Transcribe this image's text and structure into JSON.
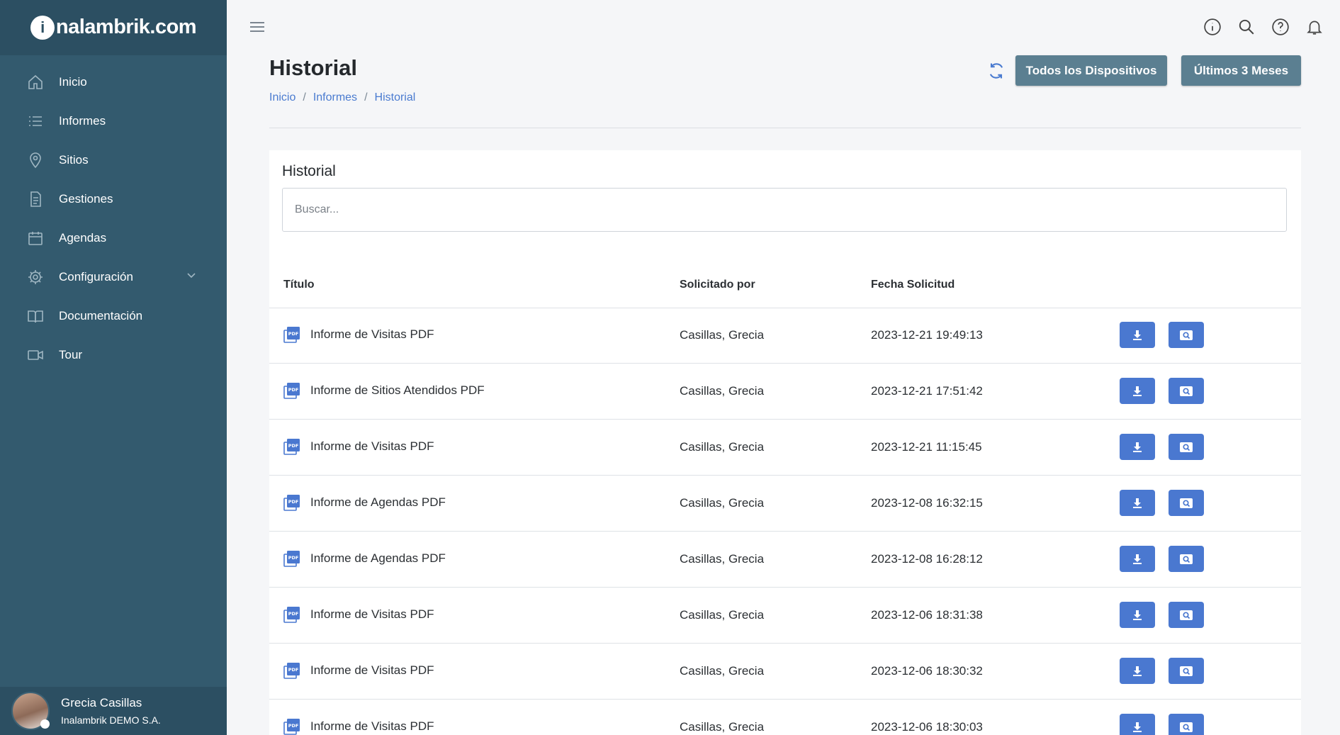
{
  "brand": {
    "mark": "i",
    "text": "nalambrik.com"
  },
  "sidebar": {
    "items": [
      {
        "label": "Inicio",
        "icon": "home-icon"
      },
      {
        "label": "Informes",
        "icon": "list-icon"
      },
      {
        "label": "Sitios",
        "icon": "map-pin-icon"
      },
      {
        "label": "Gestiones",
        "icon": "document-icon"
      },
      {
        "label": "Agendas",
        "icon": "calendar-icon"
      },
      {
        "label": "Configuración",
        "icon": "gear-icon"
      },
      {
        "label": "Documentación",
        "icon": "book-icon"
      },
      {
        "label": "Tour",
        "icon": "video-icon"
      }
    ]
  },
  "user": {
    "name": "Grecia Casillas",
    "org": "Inalambrik DEMO S.A."
  },
  "topbar": {
    "icons": [
      "info-icon",
      "search-icon",
      "help-icon",
      "bell-icon"
    ]
  },
  "header": {
    "title": "Historial",
    "breadcrumb": [
      "Inicio",
      "Informes",
      "Historial"
    ],
    "btn_devices": "Todos los Dispositivos",
    "btn_period": "Últimos 3 Meses"
  },
  "card": {
    "title": "Historial",
    "search_placeholder": "Buscar...",
    "columns": [
      "Título",
      "Solicitado por",
      "Fecha Solicitud"
    ],
    "rows": [
      {
        "title": "Informe de Visitas PDF",
        "by": "Casillas, Grecia",
        "date": "2023-12-21 19:49:13"
      },
      {
        "title": "Informe de Sitios Atendidos PDF",
        "by": "Casillas, Grecia",
        "date": "2023-12-21 17:51:42"
      },
      {
        "title": "Informe de Visitas PDF",
        "by": "Casillas, Grecia",
        "date": "2023-12-21 11:15:45"
      },
      {
        "title": "Informe de Agendas PDF",
        "by": "Casillas, Grecia",
        "date": "2023-12-08 16:32:15"
      },
      {
        "title": "Informe de Agendas PDF",
        "by": "Casillas, Grecia",
        "date": "2023-12-08 16:28:12"
      },
      {
        "title": "Informe de Visitas PDF",
        "by": "Casillas, Grecia",
        "date": "2023-12-06 18:31:38"
      },
      {
        "title": "Informe de Visitas PDF",
        "by": "Casillas, Grecia",
        "date": "2023-12-06 18:30:32"
      },
      {
        "title": "Informe de Visitas PDF",
        "by": "Casillas, Grecia",
        "date": "2023-12-06 18:30:03"
      }
    ]
  },
  "colors": {
    "sidebar": "#335a6e",
    "accent": "#4a78d0",
    "button_dark": "#5b7f91"
  }
}
